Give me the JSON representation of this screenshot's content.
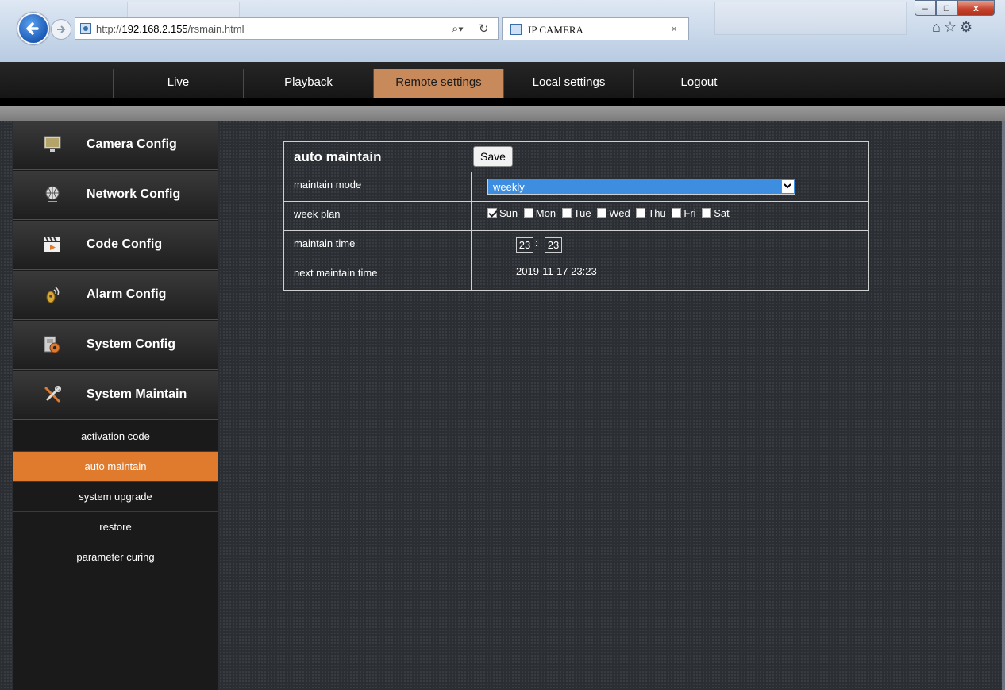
{
  "browser": {
    "url_prefix": "http://",
    "url_host": "192.168.2.155",
    "url_path": "/rsmain.html",
    "tab_title": "IP CAMERA",
    "tab_close": "×",
    "search_icon": "search-icon",
    "refresh_icon": "refresh-icon",
    "window_buttons": {
      "minimize": "–",
      "maximize": "□",
      "close": "x"
    },
    "toolbar": [
      "home-icon",
      "favorites-star-icon",
      "settings-gear-icon"
    ]
  },
  "nav": {
    "items": [
      {
        "label": "Live"
      },
      {
        "label": "Playback"
      },
      {
        "label": "Remote settings",
        "active": true
      },
      {
        "label": "Local settings"
      },
      {
        "label": "Logout"
      }
    ],
    "active_color": "#c88a5a"
  },
  "sidebar": {
    "categories": [
      {
        "label": "Camera Config",
        "icon": "monitor-icon"
      },
      {
        "label": "Network Config",
        "icon": "globe-network-icon"
      },
      {
        "label": "Code Config",
        "icon": "clapperboard-icon"
      },
      {
        "label": "Alarm Config",
        "icon": "alarm-sensor-icon"
      },
      {
        "label": "System Config",
        "icon": "gear-document-icon"
      },
      {
        "label": "System Maintain",
        "icon": "wrench-screwdriver-icon"
      }
    ],
    "sub_items": [
      {
        "label": "activation code"
      },
      {
        "label": "auto maintain",
        "active": true
      },
      {
        "label": "system upgrade"
      },
      {
        "label": "restore"
      },
      {
        "label": "parameter curing"
      }
    ],
    "active_color": "#e07b2e"
  },
  "panel": {
    "title": "auto maintain",
    "save_label": "Save",
    "rows": {
      "maintain_mode": {
        "label": "maintain mode",
        "value": "weekly"
      },
      "week_plan": {
        "label": "week plan",
        "days": [
          {
            "label": "Sun",
            "checked": true
          },
          {
            "label": "Mon",
            "checked": false
          },
          {
            "label": "Tue",
            "checked": false
          },
          {
            "label": "Wed",
            "checked": false
          },
          {
            "label": "Thu",
            "checked": false
          },
          {
            "label": "Fri",
            "checked": false
          },
          {
            "label": "Sat",
            "checked": false
          }
        ]
      },
      "maintain_time": {
        "label": "maintain time",
        "hour": "23",
        "separator": ":",
        "minute": "23"
      },
      "next_maintain_time": {
        "label": "next maintain time",
        "value": "2019-11-17 23:23"
      }
    }
  }
}
